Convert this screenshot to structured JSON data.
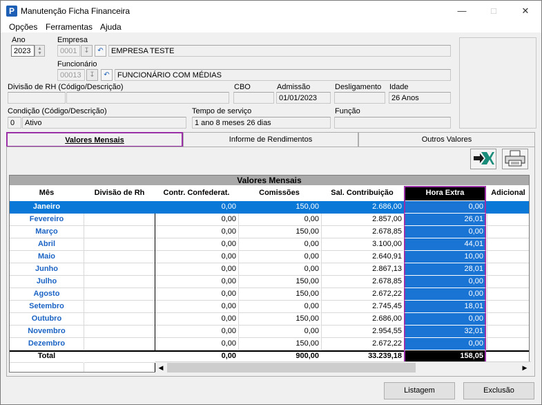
{
  "window": {
    "title": "Manutenção Ficha Financeira",
    "app_icon": "P"
  },
  "menu": [
    "Opções",
    "Ferramentas",
    "Ajuda"
  ],
  "form": {
    "ano_label": "Ano",
    "ano_value": "2023",
    "empresa_label": "Empresa",
    "empresa_code": "0001",
    "empresa_name": "EMPRESA TESTE",
    "funcionario_label": "Funcionário",
    "funcionario_code": "00013",
    "funcionario_name": "FUNCIONÁRIO COM MÉDIAS",
    "divisao_label": "Divisão de RH (Código/Descrição)",
    "cbo_label": "CBO",
    "admissao_label": "Admissão",
    "admissao_value": "01/01/2023",
    "desligamento_label": "Desligamento",
    "idade_label": "Idade",
    "idade_value": "26 Anos",
    "condicao_label": "Condição (Código/Descrição)",
    "condicao_code": "0",
    "condicao_desc": "Ativo",
    "tempo_label": "Tempo de serviço",
    "tempo_value": "1 ano 8 meses 26 dias",
    "funcao_label": "Função"
  },
  "tabs": [
    "Valores Mensais",
    "Informe de Rendimentos",
    "Outros Valores"
  ],
  "grid": {
    "title": "Valores Mensais",
    "columns": [
      "Mês",
      "Divisão de Rh",
      "Contr. Confederat.",
      "Comissões",
      "Sal. Contribuição",
      "Hora Extra",
      "Adicional"
    ],
    "rows": [
      [
        "Janeiro",
        "",
        "0,00",
        "150,00",
        "2.686,00",
        "0,00"
      ],
      [
        "Fevereiro",
        "",
        "0,00",
        "0,00",
        "2.857,00",
        "26,01"
      ],
      [
        "Março",
        "",
        "0,00",
        "150,00",
        "2.678,85",
        "0,00"
      ],
      [
        "Abril",
        "",
        "0,00",
        "0,00",
        "3.100,00",
        "44,01"
      ],
      [
        "Maio",
        "",
        "0,00",
        "0,00",
        "2.640,91",
        "10,00"
      ],
      [
        "Junho",
        "",
        "0,00",
        "0,00",
        "2.867,13",
        "28,01"
      ],
      [
        "Julho",
        "",
        "0,00",
        "150,00",
        "2.678,85",
        "0,00"
      ],
      [
        "Agosto",
        "",
        "0,00",
        "150,00",
        "2.672,22",
        "0,00"
      ],
      [
        "Setembro",
        "",
        "0,00",
        "0,00",
        "2.745,45",
        "18,01"
      ],
      [
        "Outubro",
        "",
        "0,00",
        "150,00",
        "2.686,00",
        "0,00"
      ],
      [
        "Novembro",
        "",
        "0,00",
        "0,00",
        "2.954,55",
        "32,01"
      ],
      [
        "Dezembro",
        "",
        "0,00",
        "150,00",
        "2.672,22",
        "0,00"
      ]
    ],
    "total": [
      "Total",
      "",
      "0,00",
      "900,00",
      "33.239,18",
      "158,05"
    ]
  },
  "buttons": {
    "listagem": "Listagem",
    "exclusao": "Exclusão"
  },
  "colors": {
    "selected_row": "#0a78d7",
    "hora_extra_col": "#1a74d4",
    "highlight_border": "#9b2fa8",
    "month_text": "#1a63c4"
  }
}
